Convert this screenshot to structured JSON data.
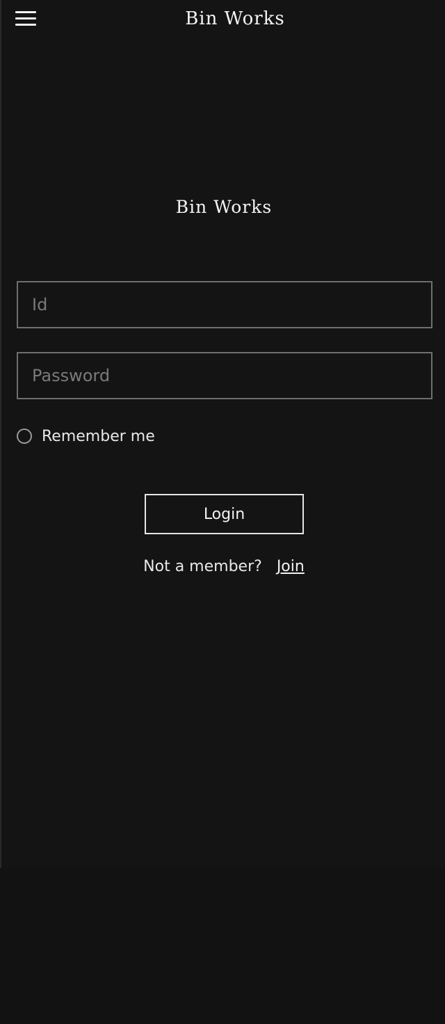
{
  "header": {
    "title": "Bin Works",
    "menu_icon": "hamburger-menu-icon"
  },
  "brand": {
    "title": "Bin Works"
  },
  "form": {
    "id_placeholder": "Id",
    "id_value": "",
    "password_placeholder": "Password",
    "password_value": "",
    "remember_label": "Remember me",
    "remember_checked": false,
    "login_label": "Login",
    "not_member_text": "Not a member?",
    "join_label": "Join"
  },
  "colors": {
    "background": "#121212",
    "text": "#e8e8e8",
    "border": "#6f6f6f"
  }
}
